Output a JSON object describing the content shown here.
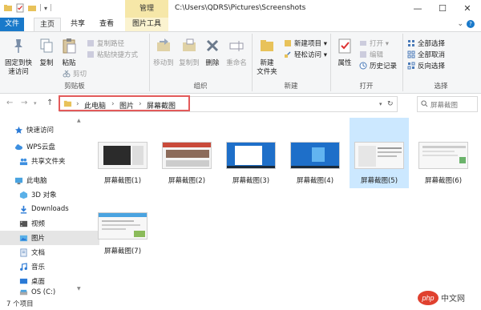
{
  "window": {
    "context_tab": "管理",
    "path_title": "C:\\Users\\QDRS\\Pictures\\Screenshots",
    "controls": [
      "—",
      "☐",
      "✕"
    ]
  },
  "tabs": {
    "file": "文件",
    "home": "主页",
    "share": "共享",
    "view": "查看",
    "picture_tools": "图片工具"
  },
  "ribbon": {
    "clipboard": {
      "label": "剪贴板",
      "pin": "固定到快\n速访问",
      "copy": "复制",
      "paste": "粘贴",
      "copy_path": "复制路径",
      "paste_shortcut": "粘贴快捷方式",
      "cut": "剪切"
    },
    "organize": {
      "label": "组织",
      "move_to": "移动到",
      "copy_to": "复制到",
      "delete": "删除",
      "rename": "重命名"
    },
    "new": {
      "label": "新建",
      "new_folder": "新建\n文件夹",
      "new_item": "新建项目 ▾",
      "easy_access": "轻松访问 ▾"
    },
    "open": {
      "label": "打开",
      "properties": "属性",
      "open": "打开 ▾",
      "edit": "编辑",
      "history": "历史记录"
    },
    "select": {
      "label": "选择",
      "select_all": "全部选择",
      "select_none": "全部取消",
      "invert": "反向选择"
    }
  },
  "address": {
    "crumbs": [
      "此电脑",
      "图片",
      "屏幕截图"
    ],
    "search_placeholder": "屏幕截图"
  },
  "nav_pane": {
    "items": [
      {
        "label": "快速访问",
        "icon": "star-icon"
      },
      {
        "label": "WPS云盘",
        "icon": "cloud-icon"
      },
      {
        "label": "共享文件夹",
        "icon": "shared-folder-icon"
      },
      {
        "label": "此电脑",
        "icon": "computer-icon"
      },
      {
        "label": "3D 对象",
        "icon": "3d-objects-icon"
      },
      {
        "label": "Downloads",
        "icon": "downloads-icon"
      },
      {
        "label": "视频",
        "icon": "video-icon"
      },
      {
        "label": "图片",
        "icon": "pictures-icon"
      },
      {
        "label": "文档",
        "icon": "documents-icon"
      },
      {
        "label": "音乐",
        "icon": "music-icon"
      },
      {
        "label": "桌面",
        "icon": "desktop-icon"
      },
      {
        "label": "OS (C:)",
        "icon": "drive-icon"
      }
    ]
  },
  "files": [
    {
      "name": "屏幕截图(1)",
      "theme": "dark"
    },
    {
      "name": "屏幕截图(2)",
      "theme": "photo"
    },
    {
      "name": "屏幕截图(3)",
      "theme": "desktop"
    },
    {
      "name": "屏幕截图(4)",
      "theme": "desktop"
    },
    {
      "name": "屏幕截图(5)",
      "theme": "window"
    },
    {
      "name": "屏幕截图(6)",
      "theme": "window"
    },
    {
      "name": "屏幕截图(7)",
      "theme": "window"
    }
  ],
  "status": {
    "count": "7 个项目"
  },
  "colors": {
    "accent": "#1979ca",
    "highlight": "#e35a5a",
    "selection": "#cce8ff"
  },
  "watermark": "php中文网"
}
